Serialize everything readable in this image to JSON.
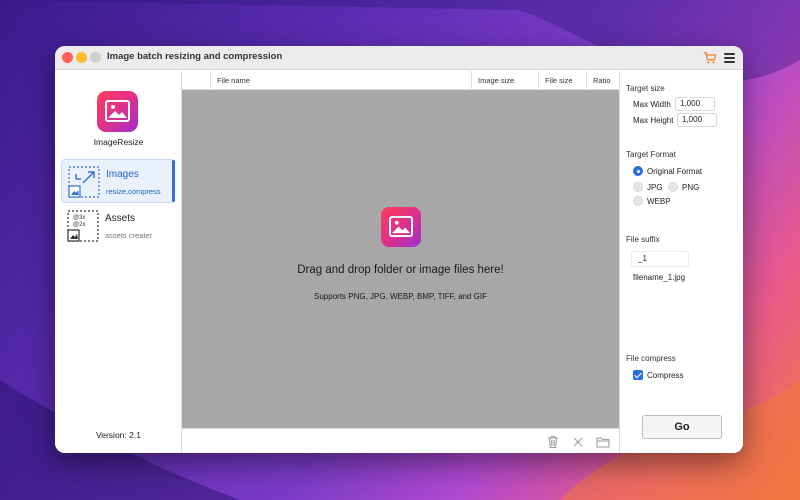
{
  "window": {
    "title": "Image batch resizing and compression"
  },
  "sidebar": {
    "app_name": "ImageResize",
    "items": [
      {
        "label": "Images",
        "sublabel": "resize,compress",
        "active": true
      },
      {
        "label": "Assets",
        "sublabel": "assets creater",
        "active": false
      }
    ],
    "version": "Version: 2.1"
  },
  "table": {
    "columns": [
      "File name",
      "Image size",
      "File size",
      "Ratio"
    ]
  },
  "drop_area": {
    "title": "Drag and drop folder or image files here!",
    "subtitle": "Supports PNG, JPG, WEBP, BMP, TIFF, and GIF"
  },
  "settings": {
    "target_size_label": "Target size",
    "max_width_label": "Max Width",
    "max_width_value": "1,000",
    "max_height_label": "Max Height",
    "max_height_value": "1,000",
    "target_format_label": "Target Format",
    "formats": [
      {
        "label": "Original Format",
        "selected": true
      },
      {
        "label": "JPG",
        "selected": false
      },
      {
        "label": "PNG",
        "selected": false
      },
      {
        "label": "WEBP",
        "selected": false
      }
    ],
    "file_suffix_label": "File suffix",
    "suffix_value": "_1",
    "suffix_example": "filename_1.jpg",
    "file_compress_label": "File compress",
    "compress_label": "Compress",
    "compress_checked": true,
    "go_label": "Go"
  },
  "icons": {
    "cart": "cart-icon",
    "menu": "menu-icon",
    "trash": "trash-icon",
    "clear": "close-icon",
    "folder": "folder-icon"
  },
  "colors": {
    "accent": "#2a6fe0",
    "cart": "#f07a20",
    "drop_bg": "#a7a7a7"
  }
}
